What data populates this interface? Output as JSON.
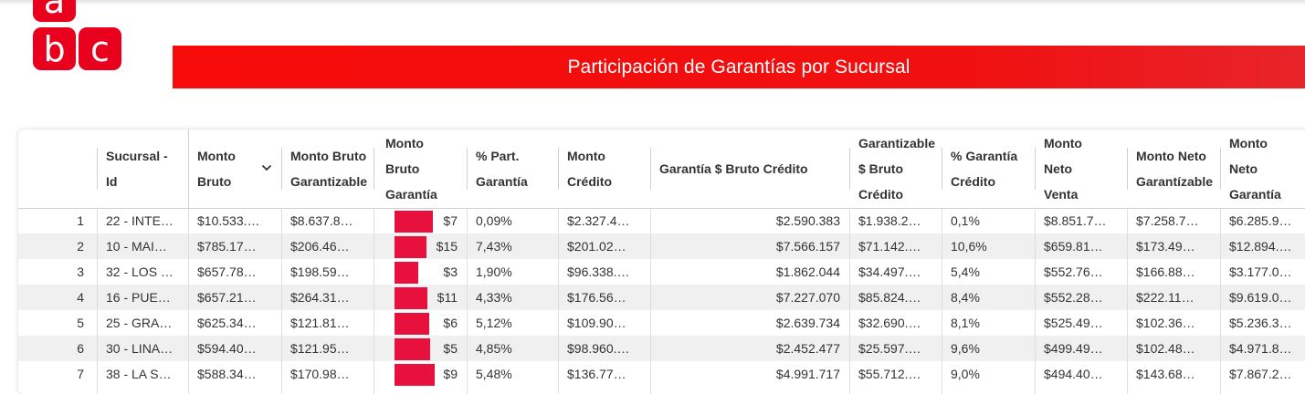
{
  "logo": {
    "letters": [
      "a",
      "b",
      "c"
    ]
  },
  "banner": {
    "title": "Participación de Garantías por Sucursal"
  },
  "colors": {
    "brand_red": "#f70a0a",
    "bar_color": "#e8103c",
    "alt_row": "#f0f0f0"
  },
  "table": {
    "columns": [
      {
        "key": "idx",
        "lines": []
      },
      {
        "key": "sucursal",
        "lines": [
          "Sucursal -",
          "Id"
        ]
      },
      {
        "key": "monto_bruto",
        "lines": [
          "Monto",
          "Bruto"
        ],
        "sort_icon": "chevron-down-icon"
      },
      {
        "key": "monto_bruto_garantizable",
        "lines": [
          "Monto Bruto",
          "Garantizable"
        ]
      },
      {
        "key": "monto_bruto_garantia",
        "lines": [
          "Monto",
          "Bruto",
          "Garantía"
        ]
      },
      {
        "key": "pct_part_garantia",
        "lines": [
          "% Part.",
          "Garantía"
        ]
      },
      {
        "key": "monto_credito",
        "lines": [
          "Monto",
          "Crédito"
        ]
      },
      {
        "key": "garantia_bruto_credito",
        "lines": [
          "Garantía $ Bruto Crédito"
        ]
      },
      {
        "key": "garantizable_bruto_credito",
        "lines": [
          "Garantizable",
          "$ Bruto",
          "Crédito"
        ]
      },
      {
        "key": "pct_garantia_credito",
        "lines": [
          "% Garantía",
          "Crédito"
        ]
      },
      {
        "key": "monto_neto_venta",
        "lines": [
          "Monto",
          "Neto",
          "Venta"
        ]
      },
      {
        "key": "monto_neto_garantizable",
        "lines": [
          "Monto Neto",
          "Garantízable"
        ]
      },
      {
        "key": "monto_neto_garantia",
        "lines": [
          "Monto",
          "Neto",
          "Garantía"
        ]
      }
    ],
    "rows": [
      {
        "idx": "1",
        "sucursal": "22 - INTE…",
        "monto_bruto": "$10.533.…",
        "monto_bruto_garantizable": "$8.637.8…",
        "garantia_bar_fraction": 0.92,
        "garantia_bar_text": "$7",
        "pct_part_garantia": "0,09%",
        "monto_credito": "$2.327.4…",
        "garantia_bruto_credito": "$2.590.383",
        "garantizable_bruto_credito": "$1.938.2…",
        "pct_garantia_credito": "0,1%",
        "monto_neto_venta": "$8.851.7…",
        "monto_neto_garantizable": "$7.258.7…",
        "monto_neto_garantia": "$6.285.9…"
      },
      {
        "idx": "2",
        "sucursal": "10 - MAI…",
        "monto_bruto": "$785.17…",
        "monto_bruto_garantizable": "$206.46…",
        "garantia_bar_fraction": 0.76,
        "garantia_bar_text": "$15",
        "pct_part_garantia": "7,43%",
        "monto_credito": "$201.02…",
        "garantia_bruto_credito": "$7.566.157",
        "garantizable_bruto_credito": "$71.142.…",
        "pct_garantia_credito": "10,6%",
        "monto_neto_venta": "$659.81…",
        "monto_neto_garantizable": "$173.49…",
        "monto_neto_garantia": "$12.894.…"
      },
      {
        "idx": "3",
        "sucursal": "32 - LOS …",
        "monto_bruto": "$657.78…",
        "monto_bruto_garantizable": "$198.59…",
        "garantia_bar_fraction": 0.56,
        "garantia_bar_text": "$3",
        "pct_part_garantia": "1,90%",
        "monto_credito": "$96.338.…",
        "garantia_bruto_credito": "$1.862.044",
        "garantizable_bruto_credito": "$34.497.…",
        "pct_garantia_credito": "5,4%",
        "monto_neto_venta": "$552.76…",
        "monto_neto_garantizable": "$166.88…",
        "monto_neto_garantia": "$3.177.0…"
      },
      {
        "idx": "4",
        "sucursal": "16 - PUE…",
        "monto_bruto": "$657.21…",
        "monto_bruto_garantizable": "$264.31…",
        "garantia_bar_fraction": 0.78,
        "garantia_bar_text": "$11",
        "pct_part_garantia": "4,33%",
        "monto_credito": "$176.56…",
        "garantia_bruto_credito": "$7.227.070",
        "garantizable_bruto_credito": "$85.824.…",
        "pct_garantia_credito": "8,4%",
        "monto_neto_venta": "$552.28…",
        "monto_neto_garantizable": "$222.11…",
        "monto_neto_garantia": "$9.619.0…"
      },
      {
        "idx": "5",
        "sucursal": "25 - GRA…",
        "monto_bruto": "$625.34…",
        "monto_bruto_garantizable": "$121.81…",
        "garantia_bar_fraction": 0.82,
        "garantia_bar_text": "$6",
        "pct_part_garantia": "5,12%",
        "monto_credito": "$109.90…",
        "garantia_bruto_credito": "$2.639.734",
        "garantizable_bruto_credito": "$32.690.…",
        "pct_garantia_credito": "8,1%",
        "monto_neto_venta": "$525.49…",
        "monto_neto_garantizable": "$102.36…",
        "monto_neto_garantia": "$5.236.3…"
      },
      {
        "idx": "6",
        "sucursal": "30 - LINA…",
        "monto_bruto": "$594.40…",
        "monto_bruto_garantizable": "$121.95…",
        "garantia_bar_fraction": 0.84,
        "garantia_bar_text": "$5",
        "pct_part_garantia": "4,85%",
        "monto_credito": "$98.960.…",
        "garantia_bruto_credito": "$2.452.477",
        "garantizable_bruto_credito": "$25.597.…",
        "pct_garantia_credito": "9,6%",
        "monto_neto_venta": "$499.49…",
        "monto_neto_garantizable": "$102.48…",
        "monto_neto_garantia": "$4.971.8…"
      },
      {
        "idx": "7",
        "sucursal": "38 - LA S…",
        "monto_bruto": "$588.34…",
        "monto_bruto_garantizable": "$170.98…",
        "garantia_bar_fraction": 0.96,
        "garantia_bar_text": "$9",
        "pct_part_garantia": "5,48%",
        "monto_credito": "$136.77…",
        "garantia_bruto_credito": "$4.991.717",
        "garantizable_bruto_credito": "$55.712.…",
        "pct_garantia_credito": "9,0%",
        "monto_neto_venta": "$494.40…",
        "monto_neto_garantizable": "$143.68…",
        "monto_neto_garantia": "$7.867.2…"
      }
    ]
  }
}
